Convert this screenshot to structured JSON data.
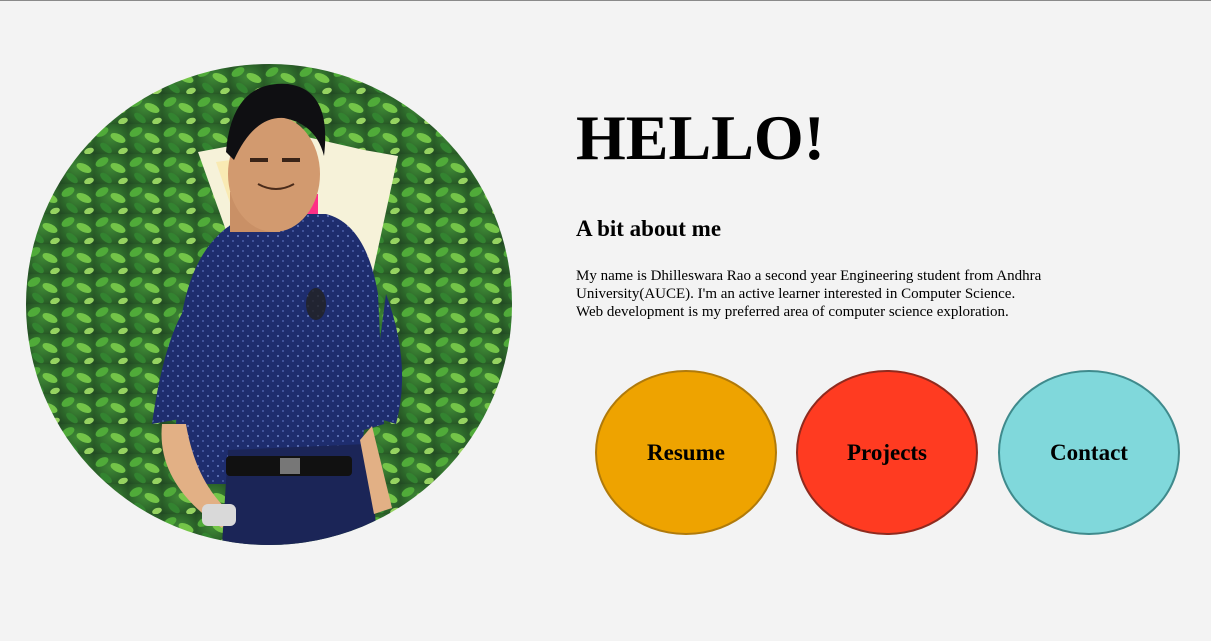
{
  "hero": {
    "greeting": "HELLO!",
    "about_heading": "A bit about me",
    "about_lines": [
      "My name is Dhilleswara Rao a second year Engineering student from Andhra",
      "University(AUCE). I'm an active learner interested in Computer Science.",
      "Web development is my preferred area of computer science exploration."
    ]
  },
  "profile_photo": {
    "subject": "profile-photo"
  },
  "nav_buttons": [
    {
      "label": "Resume",
      "fill": "#eea300",
      "border": "#b07a0a"
    },
    {
      "label": "Projects",
      "fill": "#ff3b21",
      "border": "#8f2a1e"
    },
    {
      "label": "Contact",
      "fill": "#80d8db",
      "border": "#3f8a8c"
    }
  ],
  "colors": {
    "background": "#f3f3f3",
    "text": "#000000"
  }
}
